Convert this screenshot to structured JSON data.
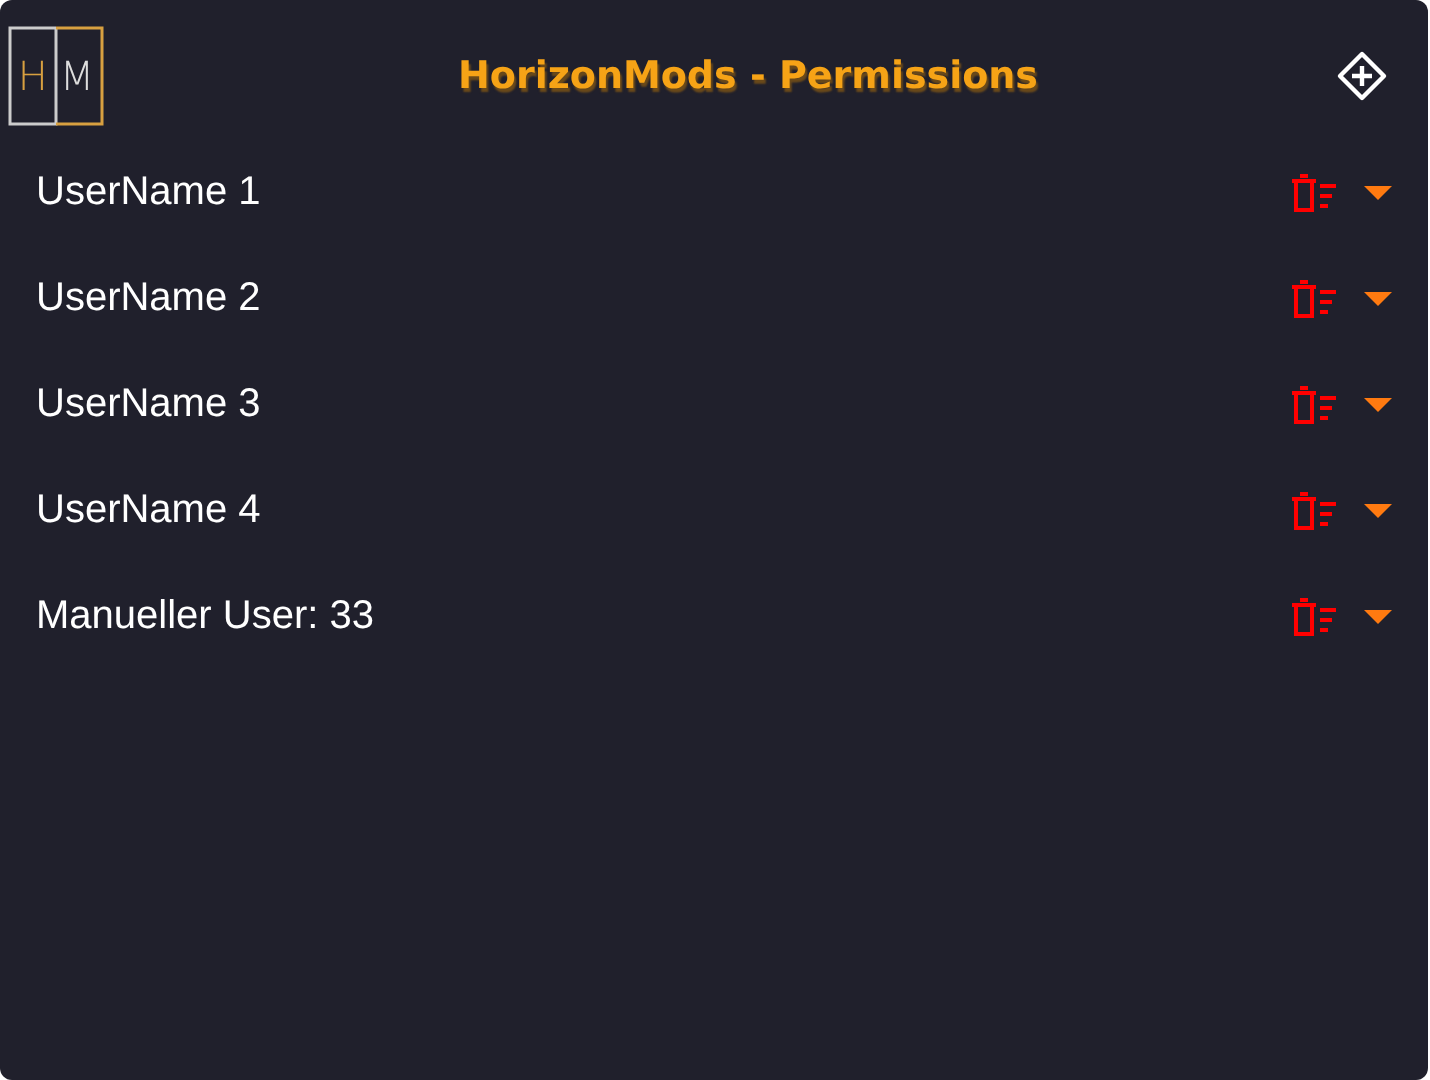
{
  "header": {
    "logo": {
      "left": "H",
      "right": "M"
    },
    "title": "HorizonMods - Permissions"
  },
  "users": [
    {
      "name": "UserName 1"
    },
    {
      "name": "UserName 2"
    },
    {
      "name": "UserName 3"
    },
    {
      "name": "UserName 4"
    },
    {
      "name": "Manueller User: 33"
    }
  ]
}
